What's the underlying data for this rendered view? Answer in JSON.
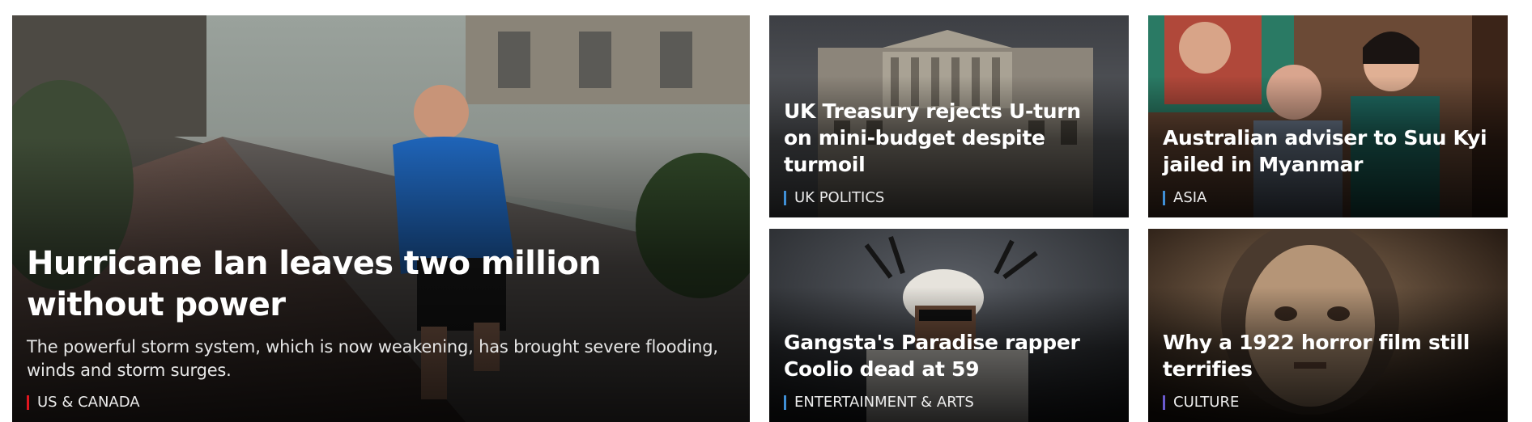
{
  "colors": {
    "tag_us_canada": "#e0161f",
    "tag_uk_politics": "#3f8fd6",
    "tag_asia": "#3f8fd6",
    "tag_entertainment": "#3f8fd6",
    "tag_culture": "#6a5acd"
  },
  "stories": [
    {
      "headline": "Hurricane Ian leaves two million without power",
      "summary": "The powerful storm system, which is now weakening, has brought severe flooding, winds and storm surges.",
      "tag": "US & CANADA",
      "image": "man-running-in-storm-photo"
    },
    {
      "headline": "UK Treasury rejects U-turn on mini-budget despite turmoil",
      "tag": "UK POLITICS",
      "image": "bank-of-england-building-photo"
    },
    {
      "headline": "Australian adviser to Suu Kyi jailed in Myanmar",
      "tag": "ASIA",
      "image": "adviser-and-suu-kyi-photo"
    },
    {
      "headline": "Gangsta's Paradise rapper Coolio dead at 59",
      "tag": "ENTERTAINMENT & ARTS",
      "image": "coolio-portrait-photo"
    },
    {
      "headline": "Why a 1922 horror film still terrifies",
      "tag": "CULTURE",
      "image": "silent-film-actress-still"
    }
  ]
}
